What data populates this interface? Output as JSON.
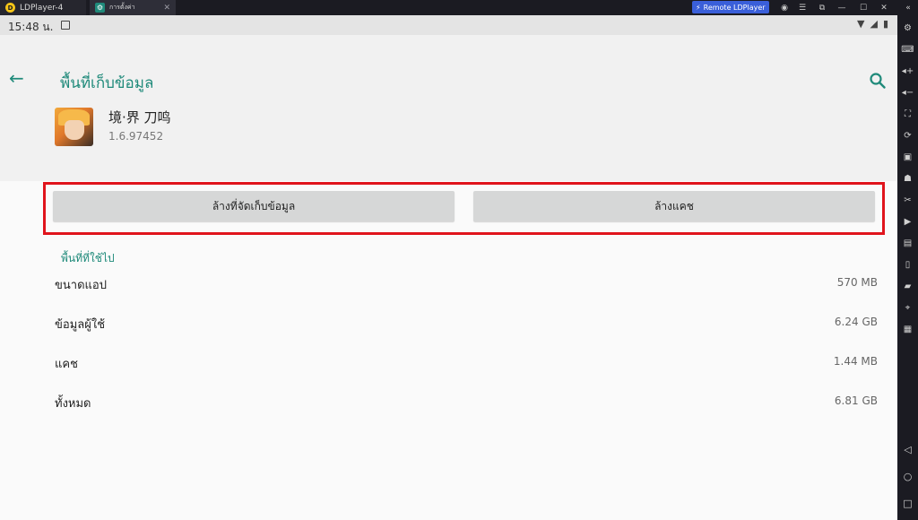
{
  "emulator": {
    "tabs": [
      {
        "label": "LDPlayer-4"
      },
      {
        "label": "การตั้งค่า"
      }
    ],
    "remote_button": "Remote LDPlayer",
    "logo_letter": "D"
  },
  "statusbar": {
    "time": "15:48 น."
  },
  "header": {
    "title": "พื้นที่เก็บข้อมูล"
  },
  "app": {
    "name": "境·界 刀鸣",
    "version": "1.6.97452"
  },
  "actions": {
    "clear_storage": "ล้างที่จัดเก็บข้อมูล",
    "clear_cache": "ล้างแคช"
  },
  "storage": {
    "section_title": "พื้นที่ที่ใช้ไป",
    "rows": [
      {
        "label": "ขนาดแอป",
        "value": "570 MB"
      },
      {
        "label": "ข้อมูลผู้ใช้",
        "value": "6.24 GB"
      },
      {
        "label": "แคช",
        "value": "1.44 MB"
      },
      {
        "label": "ทั้งหมด",
        "value": "6.81 GB"
      }
    ]
  },
  "colors": {
    "accent": "#1f8a7a",
    "highlight": "#e0141c",
    "remote": "#3a5fd9"
  }
}
